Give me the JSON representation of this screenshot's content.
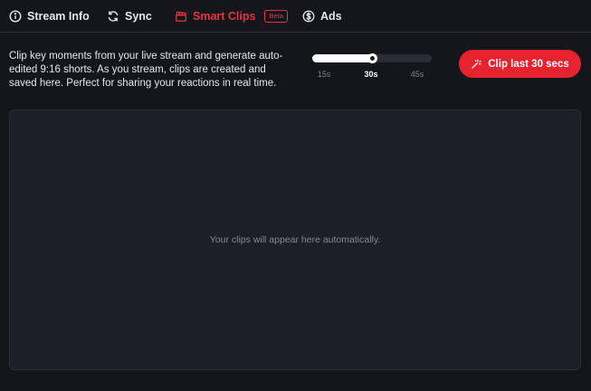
{
  "tabs": [
    {
      "label": "Stream Info",
      "icon": "info-icon",
      "active": false
    },
    {
      "label": "Sync",
      "icon": "sync-icon",
      "active": false
    },
    {
      "label": "Smart Clips",
      "icon": "clapperboard-icon",
      "active": true,
      "badge": "Beta"
    },
    {
      "label": "Ads",
      "icon": "dollar-icon",
      "active": false
    }
  ],
  "description": "Clip key moments from your live stream and generate auto-edited 9:16 shorts. As you stream, clips are created and saved here. Perfect for sharing your reactions in real time.",
  "duration_slider": {
    "options": [
      "15s",
      "30s",
      "45s"
    ],
    "selected": "30s",
    "fill_fraction": 0.5
  },
  "clip_button": {
    "label": "Clip last 30 secs",
    "icon": "magic-wand-icon"
  },
  "clips_panel": {
    "empty_message": "Your clips will appear here automatically."
  },
  "colors": {
    "accent": "#e8232f",
    "background": "#14161c",
    "panel": "#1c1f27"
  }
}
